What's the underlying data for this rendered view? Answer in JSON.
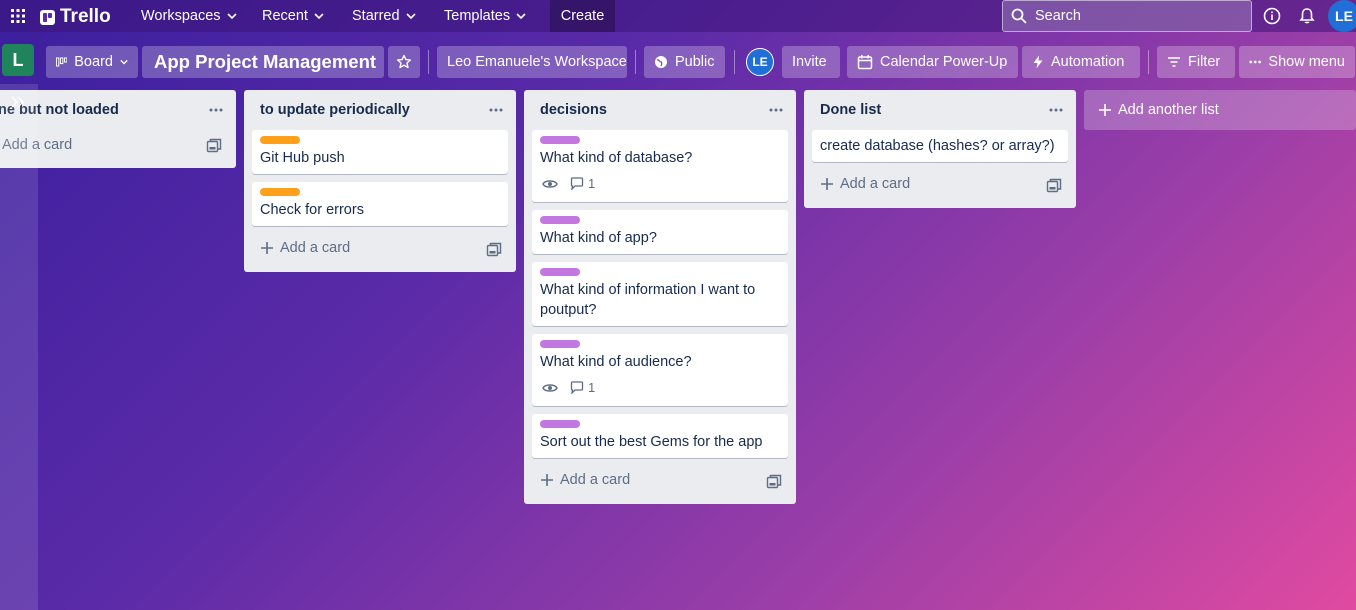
{
  "topnav": {
    "brand": "Trello",
    "workspaces": "Workspaces",
    "recent": "Recent",
    "starred": "Starred",
    "templates": "Templates",
    "create": "Create",
    "search_placeholder": "Search",
    "avatar": "LE"
  },
  "board": {
    "workspace_tile": "L",
    "view": "Board",
    "title": "App Project Management",
    "workspace": "Leo Emanuele's Workspace",
    "visibility": "Public",
    "member_avatar": "LE",
    "invite": "Invite",
    "calendar": "Calendar Power-Up",
    "automation": "Automation",
    "filter": "Filter",
    "show_menu": "Show menu"
  },
  "lists": [
    {
      "title": "ne but not loaded",
      "add_card": "Add a card",
      "cards": []
    },
    {
      "title": "to update periodically",
      "add_card": "Add a card",
      "cards": [
        {
          "title": "Git Hub push",
          "label_color": "#ff9f1a"
        },
        {
          "title": "Check for errors",
          "label_color": "#ff9f1a"
        }
      ]
    },
    {
      "title": "decisions",
      "add_card": "Add a card",
      "cards": [
        {
          "title": "What kind of database?",
          "label_color": "#c377e0",
          "comments": "1"
        },
        {
          "title": "What kind of app?",
          "label_color": "#c377e0"
        },
        {
          "title": "What kind of information I want to poutput?",
          "label_color": "#c377e0"
        },
        {
          "title": "What kind of audience?",
          "label_color": "#c377e0",
          "comments": "1"
        },
        {
          "title": "Sort out the best Gems for the app",
          "label_color": "#c377e0"
        }
      ]
    },
    {
      "title": "Done list",
      "add_card": "Add a card",
      "cards": [
        {
          "title": "create database (hashes? or array?)"
        }
      ]
    }
  ],
  "add_list": "Add another list",
  "colors": {
    "orange_label": "#ff9f1a",
    "purple_label": "#c377e0",
    "list_bg": "#ebecf0",
    "workspace_tile": "#1f845a",
    "avatar": "#1f6fd6"
  }
}
